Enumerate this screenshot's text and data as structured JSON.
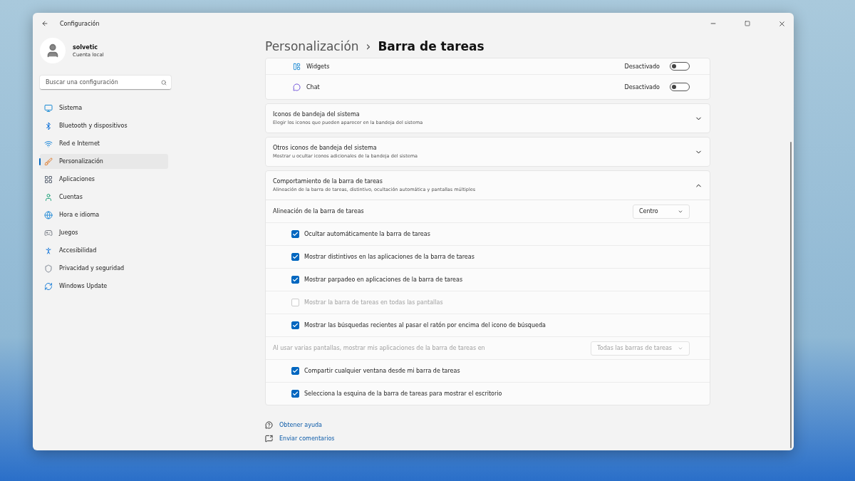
{
  "window": {
    "title": "Configuración"
  },
  "account": {
    "name": "solvetic",
    "type": "Cuenta local"
  },
  "search": {
    "placeholder": "Buscar una configuración"
  },
  "nav": [
    {
      "label": "Sistema",
      "selected": false
    },
    {
      "label": "Bluetooth y dispositivos",
      "selected": false
    },
    {
      "label": "Red e Internet",
      "selected": false
    },
    {
      "label": "Personalización",
      "selected": true
    },
    {
      "label": "Aplicaciones",
      "selected": false
    },
    {
      "label": "Cuentas",
      "selected": false
    },
    {
      "label": "Hora e idioma",
      "selected": false
    },
    {
      "label": "Juegos",
      "selected": false
    },
    {
      "label": "Accesibilidad",
      "selected": false
    },
    {
      "label": "Privacidad y seguridad",
      "selected": false
    },
    {
      "label": "Windows Update",
      "selected": false
    }
  ],
  "breadcrumb": {
    "parent": "Personalización",
    "separator": "›",
    "current": "Barra de tareas"
  },
  "taskbar_items": [
    {
      "label": "Widgets",
      "state": "Desactivado",
      "on": false
    },
    {
      "label": "Chat",
      "state": "Desactivado",
      "on": false
    }
  ],
  "sections": [
    {
      "title": "Iconos de bandeja del sistema",
      "subtitle": "Elegir los iconos que pueden aparecer en la bandeja del sistema",
      "expanded": false
    },
    {
      "title": "Otros iconos de bandeja del sistema",
      "subtitle": "Mostrar u ocultar iconos adicionales de la bandeja del sistema",
      "expanded": false
    },
    {
      "title": "Comportamiento de la barra de tareas",
      "subtitle": "Alineación de la barra de tareas, distintivo, ocultación automática y pantallas múltiples",
      "expanded": true
    }
  ],
  "behavior": [
    {
      "kind": "dropdown",
      "label": "Alineación de la barra de tareas",
      "value": "Centro",
      "disabled": false
    },
    {
      "kind": "checkbox",
      "label": "Ocultar automáticamente la barra de tareas",
      "checked": true,
      "disabled": false
    },
    {
      "kind": "checkbox",
      "label": "Mostrar distintivos en las aplicaciones de la barra de tareas",
      "checked": true,
      "disabled": false
    },
    {
      "kind": "checkbox",
      "label": "Mostrar parpadeo en aplicaciones de la barra de tareas",
      "checked": true,
      "disabled": false
    },
    {
      "kind": "checkbox",
      "label": "Mostrar la barra de tareas en todas las pantallas",
      "checked": false,
      "disabled": true
    },
    {
      "kind": "checkbox",
      "label": "Mostrar las búsquedas recientes al pasar el ratón por encima del icono de búsqueda",
      "checked": true,
      "disabled": false
    },
    {
      "kind": "dropdown",
      "label": "Al usar varias pantallas, mostrar mis aplicaciones de la barra de tareas en",
      "value": "Todas las barras de tareas",
      "disabled": true
    },
    {
      "kind": "checkbox",
      "label": "Compartir cualquier ventana desde mi barra de tareas",
      "checked": true,
      "disabled": false
    },
    {
      "kind": "checkbox",
      "label": "Selecciona la esquina de la barra de tareas para mostrar el escritorio",
      "checked": true,
      "disabled": false
    }
  ],
  "links": [
    "Obtener ayuda",
    "Enviar comentarios"
  ]
}
